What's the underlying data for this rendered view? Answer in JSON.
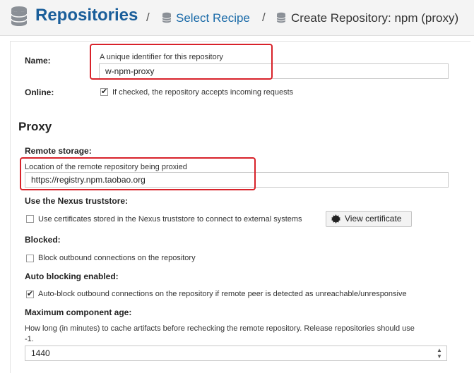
{
  "header": {
    "title": "Repositories",
    "separator": "/",
    "breadcrumb_link": "Select Recipe",
    "breadcrumb_current": "Create Repository: npm (proxy)"
  },
  "form": {
    "name": {
      "label": "Name:",
      "help": "A unique identifier for this repository",
      "value": "w-npm-proxy"
    },
    "online": {
      "label": "Online:",
      "checked": true,
      "text": "If checked, the repository accepts incoming requests"
    },
    "proxy": {
      "section_title": "Proxy",
      "remote_storage": {
        "label": "Remote storage:",
        "help": "Location of the remote repository being proxied",
        "value": "https://registry.npm.taobao.org"
      },
      "truststore": {
        "label": "Use the Nexus truststore:",
        "checked": false,
        "text": "Use certificates stored in the Nexus truststore to connect to external systems",
        "button": "View certificate"
      },
      "blocked": {
        "label": "Blocked:",
        "checked": false,
        "text": "Block outbound connections on the repository"
      },
      "auto_blocking": {
        "label": "Auto blocking enabled:",
        "checked": true,
        "text": "Auto-block outbound connections on the repository if remote peer is detected as unreachable/unresponsive"
      },
      "max_age": {
        "label": "Maximum component age:",
        "help_line1": "How long (in minutes) to cache artifacts before rechecking the remote repository. Release repositories should use",
        "help_line2": "-1.",
        "value": "1440"
      }
    }
  },
  "icons": {
    "header_icon": "database-icon",
    "crumb_icon": "database-icon",
    "certificate_icon": "certificate-badge-icon",
    "checkmark": "✔"
  },
  "colors": {
    "title": "#1a5e9a",
    "link": "#1a6aa8",
    "highlight": "#d8222a"
  }
}
